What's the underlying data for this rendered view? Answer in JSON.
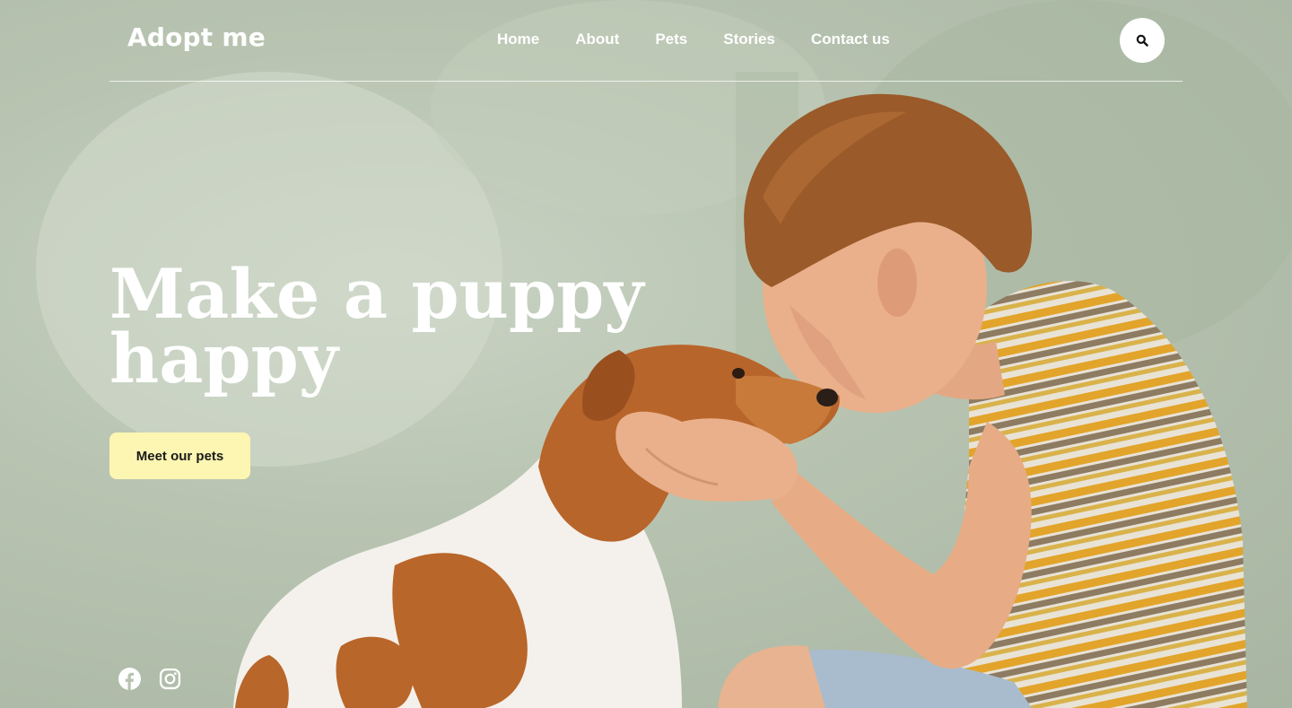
{
  "brand": {
    "logo_text": "Adopt me"
  },
  "nav": {
    "items": [
      {
        "label": "Home"
      },
      {
        "label": "About"
      },
      {
        "label": "Pets"
      },
      {
        "label": "Stories"
      },
      {
        "label": "Contact us"
      }
    ]
  },
  "search": {
    "icon": "search-icon"
  },
  "hero": {
    "headline_line1": "Make a puppy",
    "headline_line2": "happy",
    "cta_label": "Meet our pets",
    "image": "photo-boy-kissing-dog"
  },
  "social": {
    "icons": [
      "facebook-icon",
      "instagram-icon"
    ]
  },
  "colors": {
    "cta_background": "#fdf6b2",
    "text_light": "#ffffff",
    "background_tint": "#b8c4b1"
  }
}
